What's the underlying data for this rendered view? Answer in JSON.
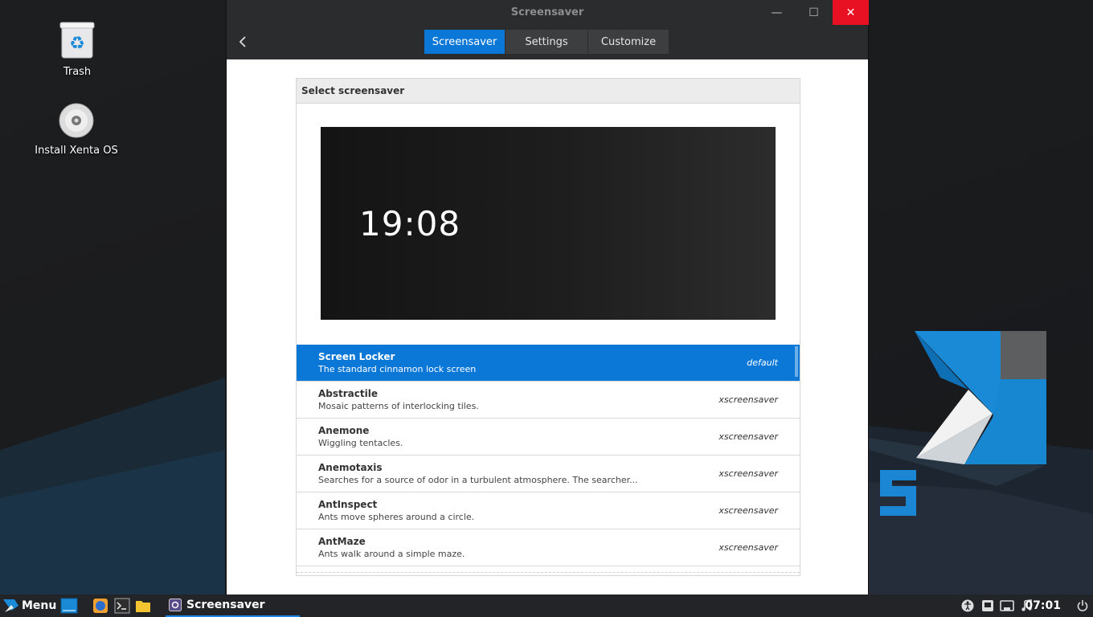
{
  "desktop": {
    "icons": [
      {
        "label": "Trash",
        "icon": "trash-icon"
      },
      {
        "label": "Install Xenta OS",
        "icon": "disc-icon"
      }
    ]
  },
  "window": {
    "title": "Screensaver",
    "tabs": [
      {
        "label": "Screensaver",
        "active": true
      },
      {
        "label": "Settings",
        "active": false
      },
      {
        "label": "Customize",
        "active": false
      }
    ],
    "controls": {
      "minimize": "—",
      "maximize": "☐",
      "close": "✕"
    },
    "accent": "#0b78d8"
  },
  "section": {
    "header": "Select screensaver",
    "preview_time": "19:08"
  },
  "screensavers": [
    {
      "name": "Screen Locker",
      "desc": "The standard cinnamon lock screen",
      "tag": "default",
      "selected": true
    },
    {
      "name": "Abstractile",
      "desc": "Mosaic patterns of interlocking tiles.",
      "tag": "xscreensaver",
      "selected": false
    },
    {
      "name": "Anemone",
      "desc": "Wiggling tentacles.",
      "tag": "xscreensaver",
      "selected": false
    },
    {
      "name": "Anemotaxis",
      "desc": "Searches for a source of odor in a turbulent atmosphere.  The searcher...",
      "tag": "xscreensaver",
      "selected": false
    },
    {
      "name": "AntInspect",
      "desc": "Ants move spheres around a circle.",
      "tag": "xscreensaver",
      "selected": false
    },
    {
      "name": "AntMaze",
      "desc": "Ants walk around a simple maze.",
      "tag": "xscreensaver",
      "selected": false
    }
  ],
  "taskbar": {
    "menu_label": "Menu",
    "active_task": "Screensaver",
    "time": "07:01"
  }
}
